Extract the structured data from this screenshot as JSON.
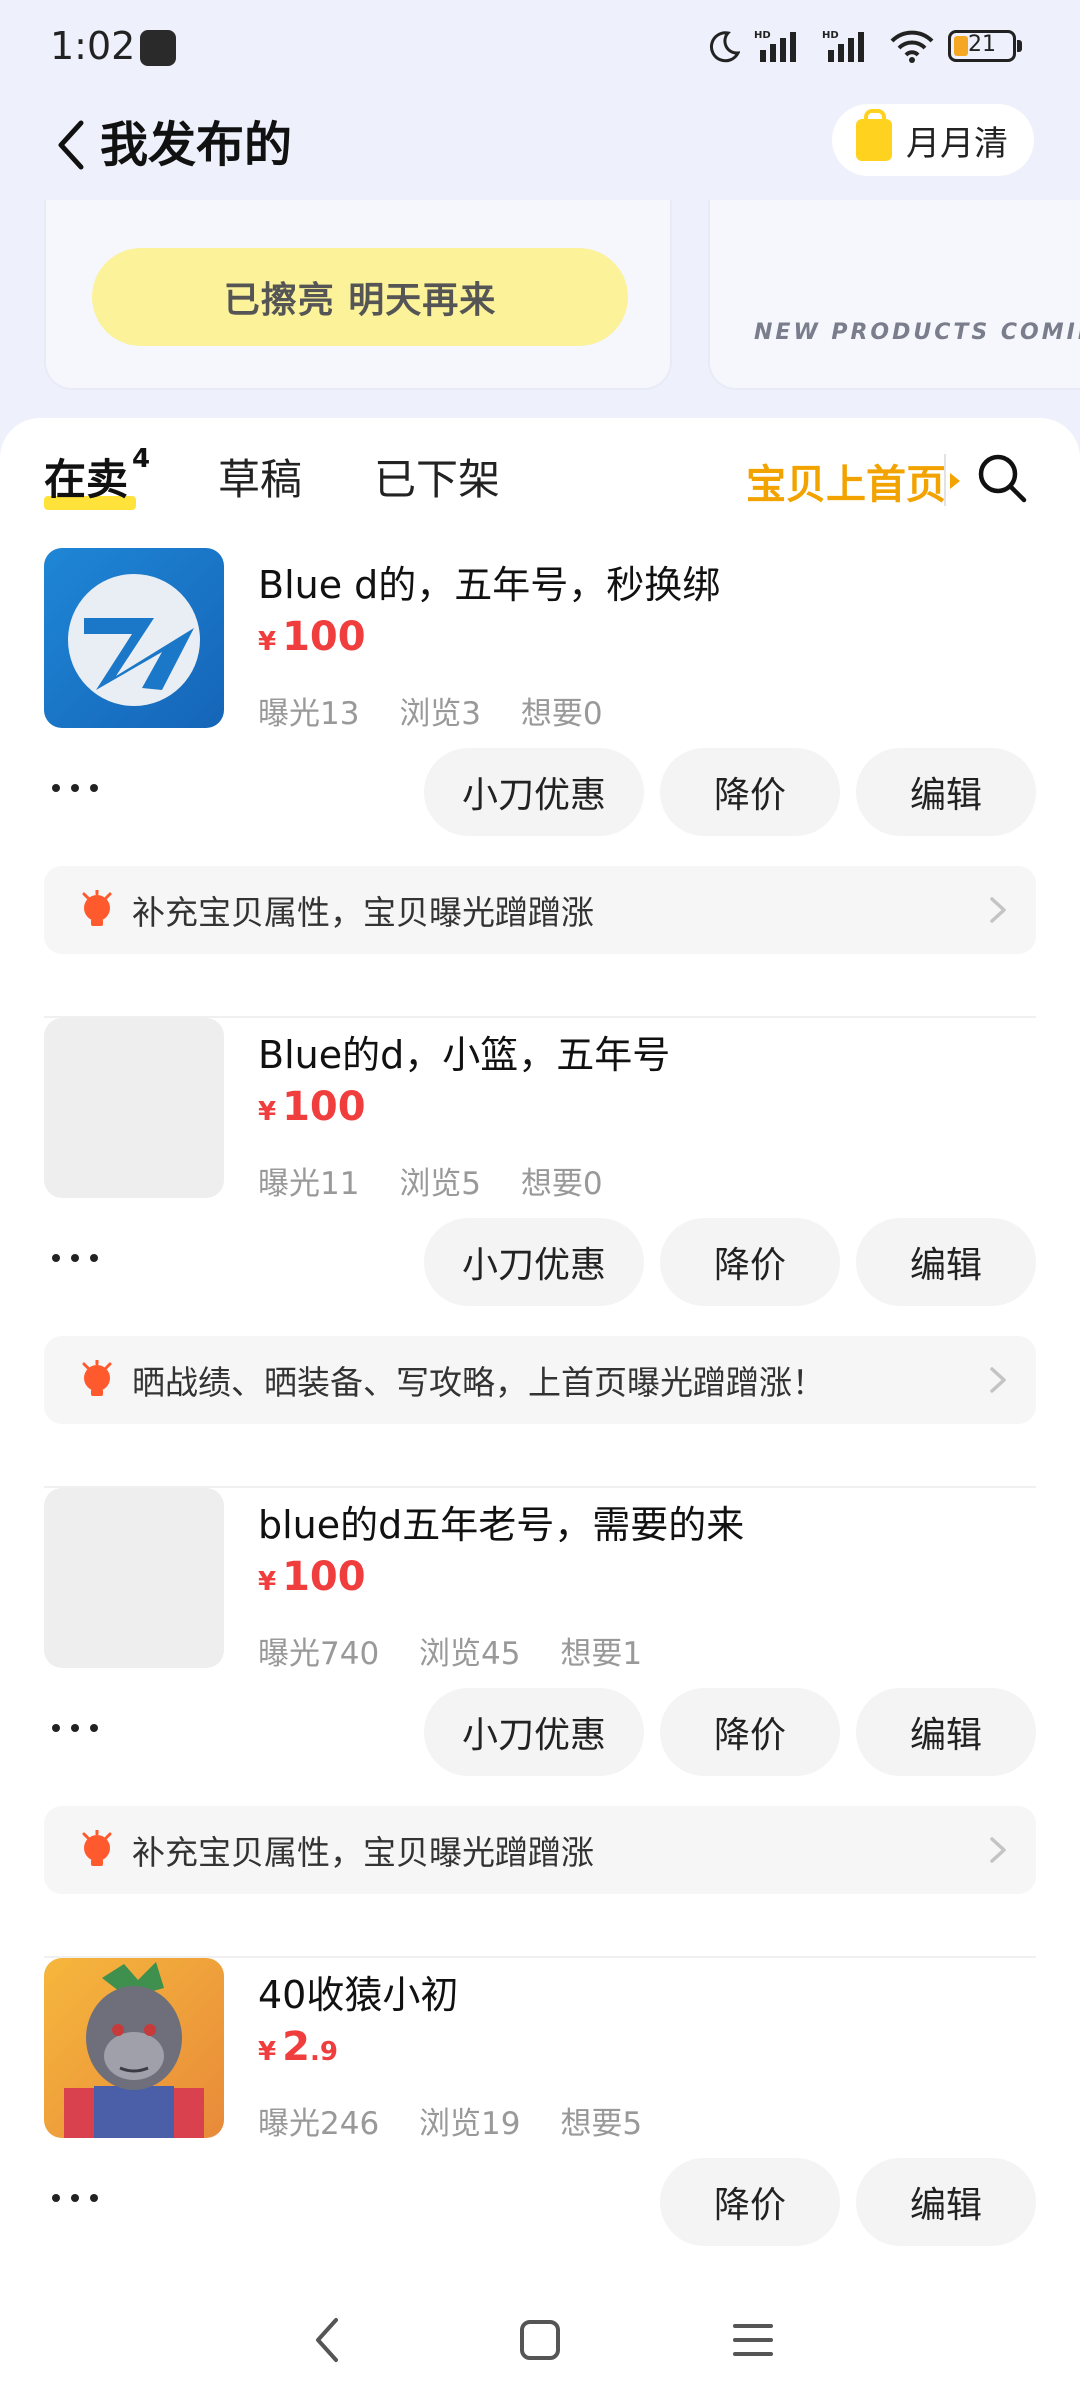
{
  "status_bar": {
    "time": "1:02",
    "battery": "21",
    "icons": [
      "moon-icon",
      "hd-signal-icon",
      "hd-signal-icon",
      "wifi-icon",
      "battery-icon"
    ]
  },
  "header": {
    "title": "我发布的",
    "monthly_button": "月月清"
  },
  "promo": {
    "shine_button": "已擦亮 明天再来",
    "new_products_text": "NEW PRODUCTS COMING S"
  },
  "tabs": {
    "on_sale": "在卖",
    "on_sale_count": "4",
    "drafts": "草稿",
    "off_shelf": "已下架",
    "homepage_link": "宝贝上首页"
  },
  "items": [
    {
      "title": "Blue d的，五年号，秒换绑",
      "currency": "¥",
      "price": "100",
      "price_decimal": "",
      "exposure": "曝光13",
      "views": "浏览3",
      "wants": "想要0",
      "buttons": [
        "小刀优惠",
        "降价",
        "编辑"
      ],
      "tip": "补充宝贝属性，宝贝曝光蹭蹭涨"
    },
    {
      "title": "Blue的d，小篮，五年号",
      "currency": "¥",
      "price": "100",
      "price_decimal": "",
      "exposure": "曝光11",
      "views": "浏览5",
      "wants": "想要0",
      "buttons": [
        "小刀优惠",
        "降价",
        "编辑"
      ],
      "tip": "晒战绩、晒装备、写攻略，上首页曝光蹭蹭涨！"
    },
    {
      "title": "blue的d五年老号，需要的来",
      "currency": "¥",
      "price": "100",
      "price_decimal": "",
      "exposure": "曝光740",
      "views": "浏览45",
      "wants": "想要1",
      "buttons": [
        "小刀优惠",
        "降价",
        "编辑"
      ],
      "tip": "补充宝贝属性，宝贝曝光蹭蹭涨"
    },
    {
      "title": "40收猿小初",
      "currency": "¥",
      "price": "2",
      "price_decimal": ".9",
      "exposure": "曝光246",
      "views": "浏览19",
      "wants": "想要5",
      "buttons": [
        "降价",
        "编辑"
      ]
    }
  ],
  "colors": {
    "price": "#f03e3e",
    "accent_orange": "#f2a300",
    "tab_highlight": "#ffe33a",
    "promo_button": "#fbf29a"
  }
}
